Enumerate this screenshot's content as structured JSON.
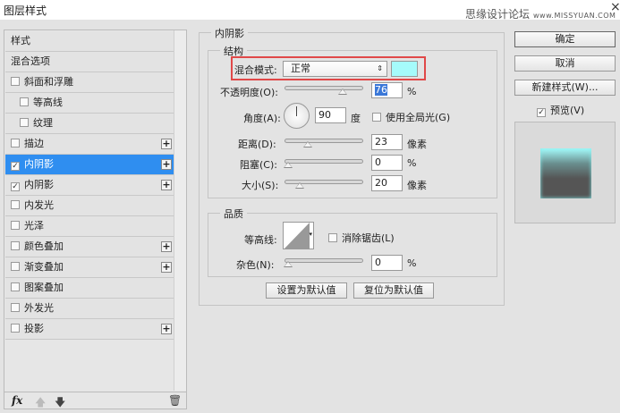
{
  "window": {
    "title": "图层样式",
    "watermark": "思缘设计论坛",
    "watermark_url": "www.MISSYUAN.COM",
    "close": "×"
  },
  "sidebar": {
    "items": [
      {
        "label": "样式",
        "checkbox": false,
        "checked": false,
        "plus": false
      },
      {
        "label": "混合选项",
        "checkbox": false,
        "checked": false,
        "plus": false
      },
      {
        "label": "斜面和浮雕",
        "checkbox": true,
        "checked": false,
        "plus": false
      },
      {
        "label": "等高线",
        "checkbox": true,
        "checked": false,
        "plus": false,
        "indent": true
      },
      {
        "label": "纹理",
        "checkbox": true,
        "checked": false,
        "plus": false,
        "indent": true
      },
      {
        "label": "描边",
        "checkbox": true,
        "checked": false,
        "plus": true
      },
      {
        "label": "内阴影",
        "checkbox": true,
        "checked": true,
        "plus": true,
        "selected": true
      },
      {
        "label": "内阴影",
        "checkbox": true,
        "checked": true,
        "plus": true
      },
      {
        "label": "内发光",
        "checkbox": true,
        "checked": false,
        "plus": false
      },
      {
        "label": "光泽",
        "checkbox": true,
        "checked": false,
        "plus": false
      },
      {
        "label": "颜色叠加",
        "checkbox": true,
        "checked": false,
        "plus": true
      },
      {
        "label": "渐变叠加",
        "checkbox": true,
        "checked": false,
        "plus": true
      },
      {
        "label": "图案叠加",
        "checkbox": true,
        "checked": false,
        "plus": false
      },
      {
        "label": "外发光",
        "checkbox": true,
        "checked": false,
        "plus": false
      },
      {
        "label": "投影",
        "checkbox": true,
        "checked": false,
        "plus": true
      }
    ],
    "toolbar": {
      "fx": "fx",
      "up": "🡅",
      "down": "🡇",
      "trash": "🗑"
    }
  },
  "panel": {
    "title": "内阴影",
    "structure": {
      "title": "结构",
      "blend_label": "混合模式:",
      "blend_value": "正常",
      "color": "#a5fbfb",
      "opacity_label": "不透明度(O):",
      "opacity": "76",
      "opacity_unit": "%",
      "angle_label": "角度(A):",
      "angle": "90",
      "angle_unit": "度",
      "global_light": "使用全局光(G)",
      "distance_label": "距离(D):",
      "distance": "23",
      "distance_unit": "像素",
      "choke_label": "阻塞(C):",
      "choke": "0",
      "choke_unit": "%",
      "size_label": "大小(S):",
      "size": "20",
      "size_unit": "像素"
    },
    "quality": {
      "title": "品质",
      "contour_label": "等高线:",
      "antialias": "消除锯齿(L)",
      "noise_label": "杂色(N):",
      "noise": "0",
      "noise_unit": "%"
    },
    "set_default": "设置为默认值",
    "reset_default": "复位为默认值"
  },
  "right": {
    "ok": "确定",
    "cancel": "取消",
    "new_style": "新建样式(W)...",
    "preview": "预览(V)"
  }
}
